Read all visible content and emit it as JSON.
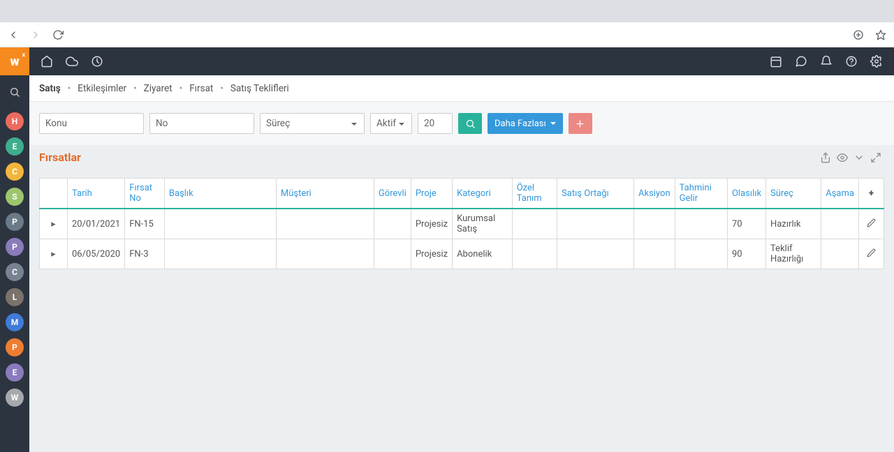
{
  "browser": {},
  "logo": "w",
  "rail_avatars": [
    {
      "letter": "H",
      "color": "#ec6b5e"
    },
    {
      "letter": "E",
      "color": "#3fae8e"
    },
    {
      "letter": "C",
      "color": "#f2b63c"
    },
    {
      "letter": "S",
      "color": "#9cc56d"
    },
    {
      "letter": "P",
      "color": "#6a7a88"
    },
    {
      "letter": "P",
      "color": "#8a7bb9"
    },
    {
      "letter": "C",
      "color": "#788293"
    },
    {
      "letter": "L",
      "color": "#7b726c"
    },
    {
      "letter": "M",
      "color": "#3f7bd8"
    },
    {
      "letter": "P",
      "color": "#ed7d32"
    },
    {
      "letter": "E",
      "color": "#8a7bbd"
    },
    {
      "letter": "W",
      "color": "#a7a9ac"
    }
  ],
  "breadcrumb": {
    "items": [
      "Satış",
      "Etkileşimler",
      "Ziyaret",
      "Fırsat",
      "Satış Teklifleri"
    ],
    "active_index": 0
  },
  "filters": {
    "subject_placeholder": "Konu",
    "no_placeholder": "No",
    "process_label": "Süreç",
    "status_label": "Aktif",
    "count_value": "20",
    "more_label": "Daha Fazlası"
  },
  "section": {
    "title": "Fırsatlar"
  },
  "table": {
    "columns": [
      "Tarih",
      "Fırsat No",
      "Başlık",
      "Müşteri",
      "Görevli",
      "Proje",
      "Kategori",
      "Özel Tanım",
      "Satış Ortağı",
      "Aksiyon",
      "Tahmini Gelir",
      "Olasılık",
      "Süreç",
      "Aşama"
    ],
    "rows": [
      {
        "tarih": "20/01/2021",
        "no": "FN-15",
        "baslik": "",
        "musteri": "",
        "gorevli": "",
        "proje": "Projesiz",
        "kategori": "Kurumsal Satış",
        "ozel": "",
        "ortak": "",
        "aksiyon": "",
        "gelir": "",
        "olasilik": "70",
        "surec": "Hazırlık",
        "asama": ""
      },
      {
        "tarih": "06/05/2020",
        "no": "FN-3",
        "baslik": "",
        "musteri": "",
        "gorevli": "",
        "proje": "Projesiz",
        "kategori": "Abonelik",
        "ozel": "",
        "ortak": "",
        "aksiyon": "",
        "gelir": "",
        "olasilik": "90",
        "surec": "Teklif Hazırlığı",
        "asama": ""
      }
    ]
  }
}
